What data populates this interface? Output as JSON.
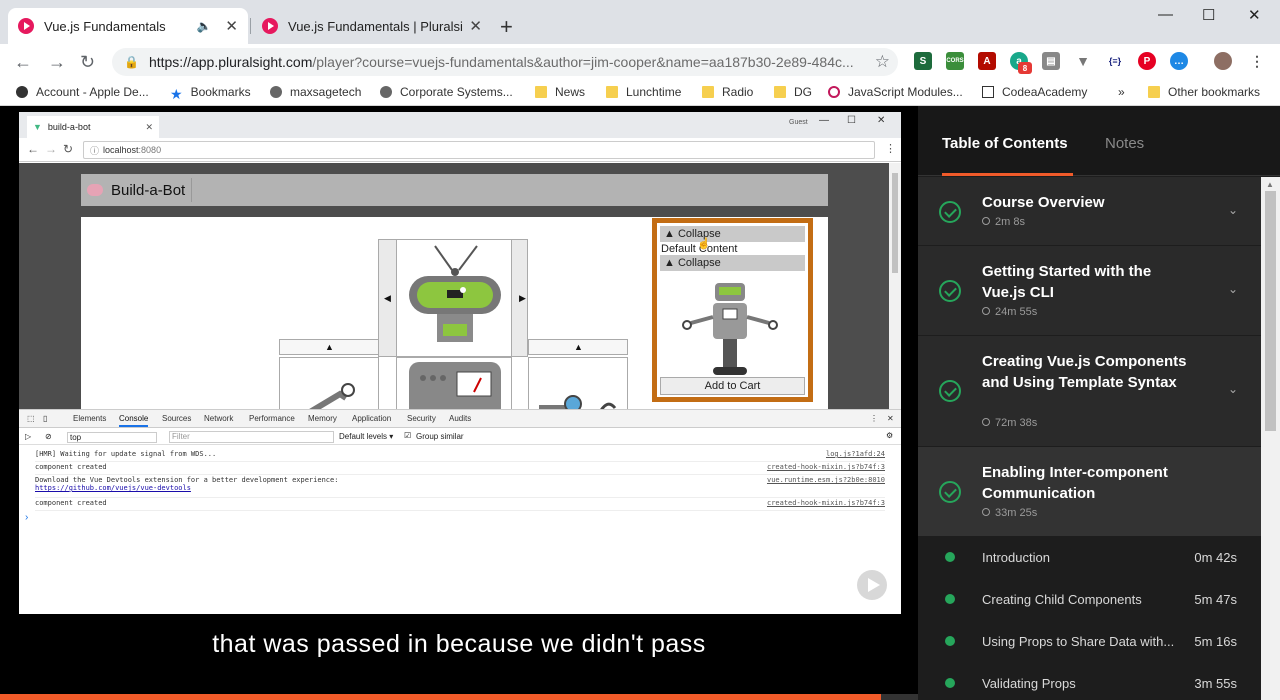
{
  "browser": {
    "tabs": [
      {
        "title": "Vue.js Fundamentals",
        "active": true
      },
      {
        "title": "Vue.js Fundamentals | Pluralsight",
        "active": false
      }
    ],
    "new_tab": "+",
    "window": {
      "minimize": "—",
      "maximize": "☐",
      "close": "✕"
    },
    "nav": {
      "back": "←",
      "forward": "→",
      "reload": "↻"
    },
    "url_main": "https://app.pluralsight.com",
    "url_rest": "/player?course=vuejs-fundamentals&author=jim-cooper&name=aa187b30-2e89-484c...",
    "star": "☆",
    "bookmarks": [
      {
        "label": "Account - Apple De...",
        "icon": "apple-icon"
      },
      {
        "label": "Bookmarks",
        "icon": "star-icon"
      },
      {
        "label": "maxsagetech",
        "icon": "globe-icon"
      },
      {
        "label": "Corporate Systems...",
        "icon": "globe-icon"
      },
      {
        "label": "News",
        "icon": "folder-icon"
      },
      {
        "label": "Lunchtime",
        "icon": "folder-icon"
      },
      {
        "label": "Radio",
        "icon": "folder-icon"
      },
      {
        "label": "DG",
        "icon": "folder-icon"
      },
      {
        "label": "JavaScript Modules...",
        "icon": "site-icon"
      },
      {
        "label": "CodeaAcademy",
        "icon": "site-icon"
      },
      {
        "label": "»",
        "icon": ""
      },
      {
        "label": "Other bookmarks",
        "icon": "folder-icon"
      }
    ],
    "ext_badge": "8"
  },
  "inner_browser": {
    "tab_title": "build-a-bot",
    "url_host": "localhost",
    "url_port": ":8080",
    "user_label": "Guest"
  },
  "app": {
    "title": "Build-a-Bot",
    "collapse_label": "▲ Collapse",
    "default_content": "Default Content",
    "add_to_cart": "Add to Cart",
    "arrow_left": "◀",
    "arrow_right": "▶",
    "arrow_up": "▲"
  },
  "devtools": {
    "tabs": [
      "Elements",
      "Console",
      "Sources",
      "Network",
      "Performance",
      "Memory",
      "Application",
      "Security",
      "Audits"
    ],
    "context": "top",
    "filter_placeholder": "Filter",
    "levels": "Default levels ▾",
    "group_similar": "Group similar",
    "logs": [
      {
        "text": "[HMR] Waiting for update signal from WDS...",
        "src": "log.js?1afd:24"
      },
      {
        "text": "component created",
        "src": "created-hook-mixin.js?b74f:3"
      },
      {
        "text": "Download the Vue Devtools extension for a better development experience:",
        "link": "https://github.com/vuejs/vue-devtools",
        "src": "vue.runtime.esm.js?2b0e:8010"
      },
      {
        "text": "component created",
        "src": "created-hook-mixin.js?b74f:3"
      }
    ],
    "prompt": "›"
  },
  "player": {
    "caption": "that was passed in because we didn't pass",
    "progress": 0.96
  },
  "toc": {
    "tabs": [
      "Table of Contents",
      "Notes"
    ],
    "modules": [
      {
        "title": "Course Overview",
        "duration": "2m 8s"
      },
      {
        "title": "Getting Started with the Vue.js CLI",
        "duration": "24m 55s"
      },
      {
        "title": "Creating Vue.js Components and Using Template Syntax",
        "duration": "72m 38s"
      },
      {
        "title": "Enabling Inter-component Communication",
        "duration": "33m 25s"
      }
    ],
    "clips": [
      {
        "title": "Introduction",
        "duration": "0m 42s"
      },
      {
        "title": "Creating Child Components",
        "duration": "5m 47s"
      },
      {
        "title": "Using Props to Share Data with...",
        "duration": "5m 16s"
      },
      {
        "title": "Validating Props",
        "duration": "3m 55s"
      }
    ],
    "colors": {
      "accent": "#f15b2a",
      "check": "#26a65b"
    }
  }
}
